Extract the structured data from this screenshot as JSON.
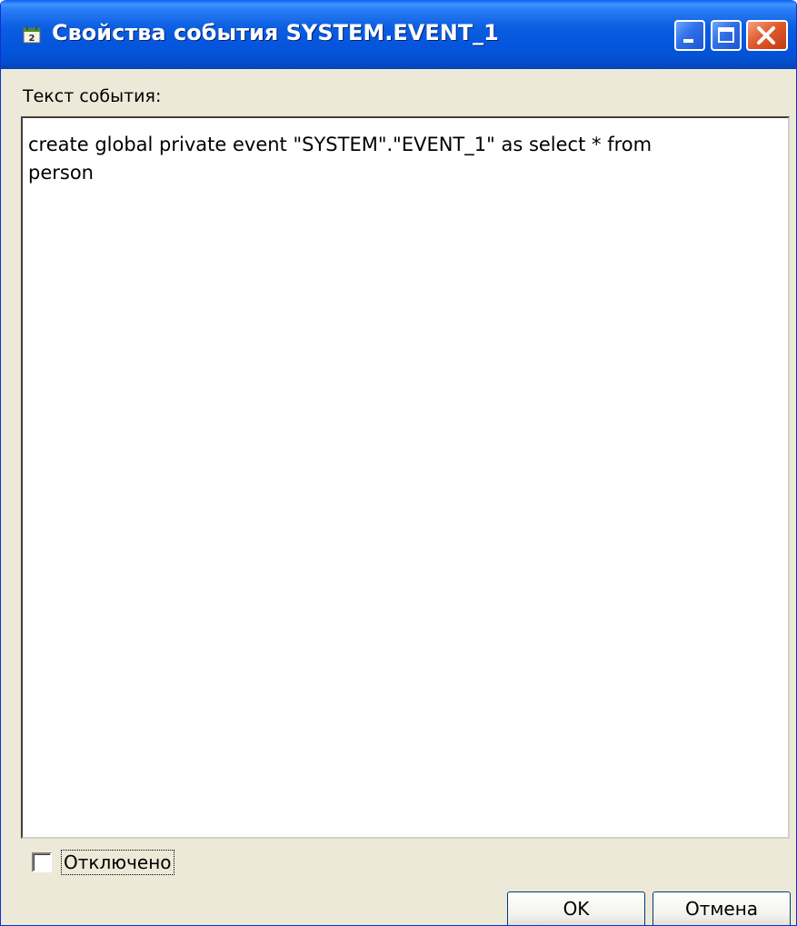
{
  "window": {
    "title": "Свойства события SYSTEM.EVENT_1",
    "title_icon": "calendar-icon",
    "controls": {
      "minimize_icon": "minimize-icon",
      "maximize_icon": "maximize-icon",
      "close_icon": "close-icon"
    },
    "colors": {
      "titlebar": "#0a5ee0",
      "close_button": "#e05b2e",
      "background": "#ece9d8"
    }
  },
  "form": {
    "event_text_label": "Текст события:",
    "event_text_value": "create global private event \"SYSTEM\".\"EVENT_1\" as select * from\nperson",
    "disabled_label": "Отключено",
    "disabled_checked": false
  },
  "buttons": {
    "ok_label": "OK",
    "cancel_label": "Отмена"
  }
}
